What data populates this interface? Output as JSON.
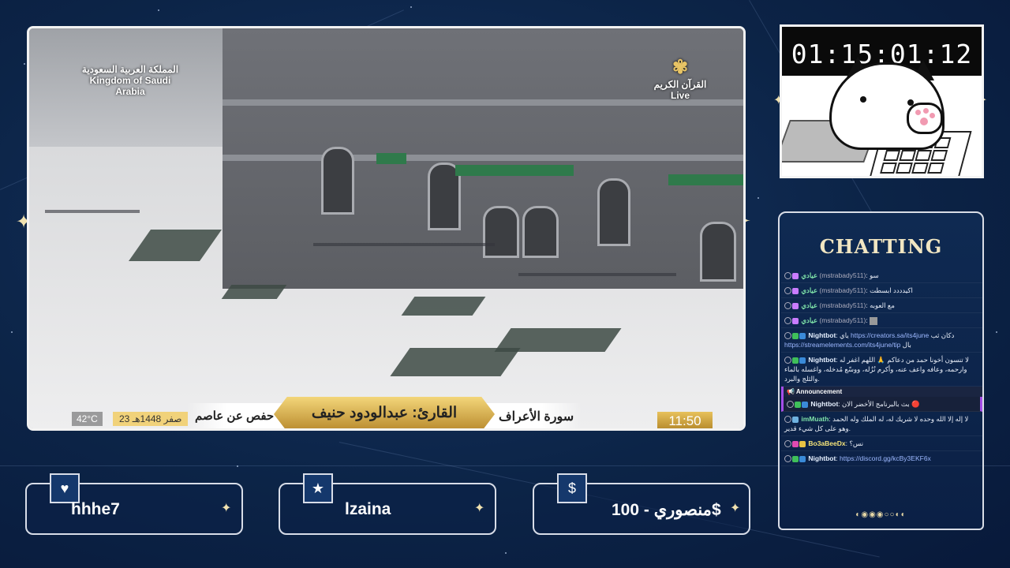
{
  "stream": {
    "video": {
      "channel_logo_ar": "المملكة العربية السعودية",
      "channel_logo_en": "Kingdom of Saudi Arabia",
      "quran_channel_ar": "القرآن الكريم",
      "quran_channel_live": "Live",
      "reciter": "القارئ: عبدالودود حنيف",
      "riwaya": "رواية حفص عن عاصم",
      "surah": "سورة الأعراف",
      "clock": "11:50",
      "temperature": "42°C",
      "hijri_date": "23 صفر 1448هـ"
    },
    "timer": "01:15:01:12"
  },
  "chat": {
    "title": "CHATTING",
    "messages": [
      {
        "nick": "عيادي",
        "user": "(mstrabady511)",
        "text": "سو",
        "nick_color": "#7ee2a8"
      },
      {
        "nick": "عيادي",
        "user": "(mstrabady511)",
        "text": "اكيدددد ابسطت",
        "nick_color": "#7ee2a8"
      },
      {
        "nick": "عيادي",
        "user": "(mstrabady511)",
        "text": "مع العوبه",
        "nick_color": "#7ee2a8"
      },
      {
        "nick": "عيادي",
        "user": "(mstrabady511)",
        "text": "",
        "nick_color": "#7ee2a8"
      },
      {
        "nick": "Nightbot",
        "text": "دكان ثب",
        "link1": "https://creators.sa/its4june",
        "text2": "بال",
        "link2": "https://streamelements.com/its4june/tip",
        "text3": "ياي",
        "nick_color": "#e6f0ff"
      },
      {
        "nick": "Nightbot",
        "text": "لا تنسون أخونا حمد من دعاكم 🙏 اللهم اغفر له وارحمه، وعافه واعف عنه، وأكرم نُزُله، ووسّع مُدخله، واغسله بالماء والثلج والبرد.",
        "nick_color": "#e6f0ff"
      },
      {
        "announcement_label": "Announcement",
        "nick": "Nightbot",
        "text": "بث بالبرنامج الأخضر الان 🔴",
        "nick_color": "#e6f0ff"
      },
      {
        "nick": "imMuath",
        "text": "لا إله إلا الله وحده لا شريك له، له الملك وله الحمد وهو على كل شيء قدير.",
        "nick_color": "#7ee2a8"
      },
      {
        "nick": "Bo3aBeeDx",
        "text": "نس؟",
        "nick_color": "#f3e27a"
      },
      {
        "nick": "Nightbot",
        "link1": "https://discord.gg/kcBy3EKF6x",
        "nick_color": "#e6f0ff"
      }
    ],
    "page_dots": "◐◉◉◉○○◐◐"
  },
  "panels": [
    {
      "icon": "heart-icon",
      "glyph": "♥",
      "text": "hhhe7"
    },
    {
      "icon": "star-icon",
      "glyph": "★",
      "text": "lzaina"
    },
    {
      "icon": "dollar-icon",
      "glyph": "$",
      "text": "منصوري - 100$"
    }
  ],
  "colors": {
    "background": "#0c2447",
    "accent_gold": "#f1e2b0",
    "frame": "#f2f2f2"
  }
}
